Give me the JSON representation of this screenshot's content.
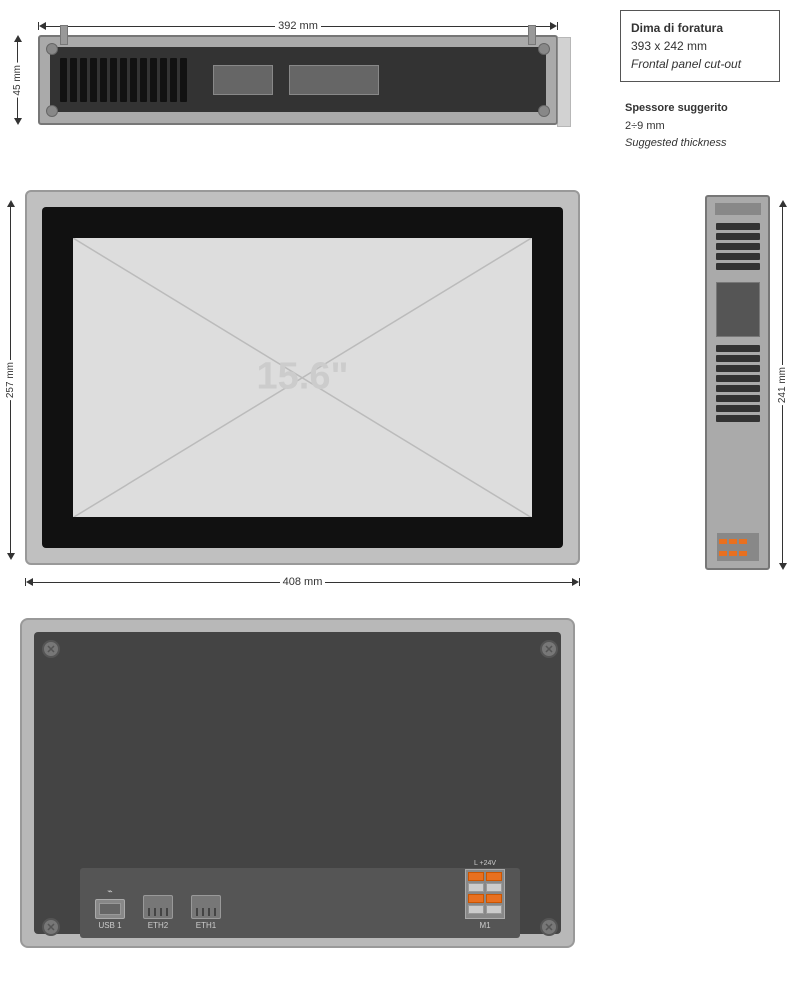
{
  "annotations": {
    "cutout_box": {
      "line1_it": "Dima di foratura",
      "line2_dim": "393 x 242 mm",
      "line3_en": "Frontal panel cut-out"
    },
    "thickness": {
      "line1_it": "Spessore suggerito",
      "line2_val": "2÷9 mm",
      "line3_en": "Suggested thickness"
    }
  },
  "dimensions": {
    "top_width": "392 mm",
    "front_width": "408 mm",
    "front_height": "257 mm",
    "side_height": "241 mm",
    "top_height": "45 mm"
  },
  "screen": {
    "size_label": "15.6\""
  },
  "ports": {
    "usb": "USB 1",
    "eth2": "ETH2",
    "eth1": "ETH1",
    "m1": "M1",
    "m1_label": "L +24V"
  }
}
